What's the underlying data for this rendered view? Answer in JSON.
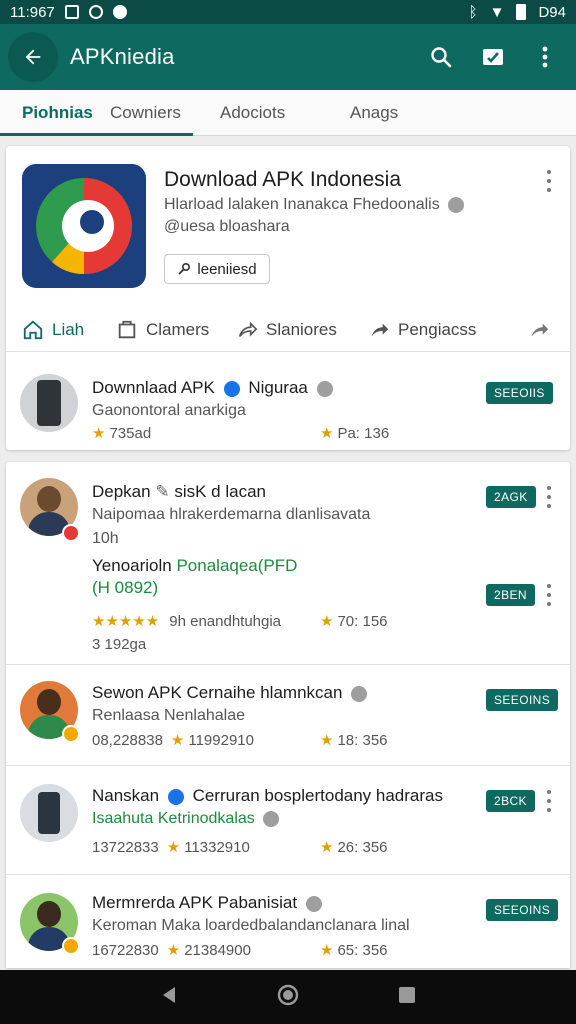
{
  "status_bar": {
    "time": "11:967",
    "battery": "D94"
  },
  "app_bar": {
    "title": "APKniedia"
  },
  "tabs": [
    {
      "label": "Piohnias",
      "active": true
    },
    {
      "label": "Cowniers"
    },
    {
      "label": "Adociots"
    },
    {
      "label": "Anags"
    }
  ],
  "app_header": {
    "title": "Download APK Indonesia",
    "subtitle_1": "Hlarload lalaken Inanakca Fhedoonalis",
    "subtitle_2": "@uesa bloashara",
    "license_button": "leeniiesd",
    "actions": [
      {
        "label": "Liah",
        "icon": "home-icon"
      },
      {
        "label": "Clamers",
        "icon": "bookmark-icon"
      },
      {
        "label": "Slaniores",
        "icon": "share-icon"
      },
      {
        "label": "Pengiacss",
        "icon": "forward-icon"
      }
    ]
  },
  "featured": {
    "title": "Downnlaad APK",
    "title_after": "Niguraa",
    "subtitle": "Gaonontoral anarkiga",
    "left_meta": "735ad",
    "right_meta": "Pa: 136",
    "badge": "SEEOIIS"
  },
  "posts": [
    {
      "title": "Depkan",
      "title_after": "sisK d lacan",
      "subtitle": "Naipomaa hlrakerdemarna dlanlisavata",
      "extra_line": "10h",
      "content_prefix": "Yenoarioln",
      "content_highlight": "Ponalaqea(PFD",
      "content_line2": "(H 0892)",
      "rating_label": "9h enandhtuhgia",
      "count": "3 192ga",
      "right_meta": "70: 156",
      "badge": "2AGK",
      "badge_2": "2BEN"
    },
    {
      "title": "Sewon APK",
      "title_after": "Cernaihe hlamnkcan",
      "subtitle": "Renlaasa Nenlahalae",
      "left_meta": "08,228838",
      "mid_meta": "11992910",
      "right_meta": "18: 356",
      "badge": "SEEOINS"
    },
    {
      "title": "Nanskan",
      "title_after": "Cerruran bosplertodany hadraras",
      "subtitle": "Isaahuta Ketrinodkalas",
      "left_meta": "13722833",
      "mid_meta": "11332910",
      "right_meta": "26: 356",
      "badge": "2BCK"
    },
    {
      "title": "Mermrerda APK Pabanisiat",
      "subtitle": "Keroman Maka loardedbalandanclanara linal",
      "left_meta": "16722830",
      "mid_meta": "21384900",
      "right_meta": "65: 356",
      "badge": "SEEOINS"
    }
  ],
  "colors": {
    "primary": "#0e6a60",
    "primary_dark": "#0b4a45",
    "star": "#e0a000",
    "verified": "#1a73e8",
    "link_green": "#1e8a3c"
  }
}
